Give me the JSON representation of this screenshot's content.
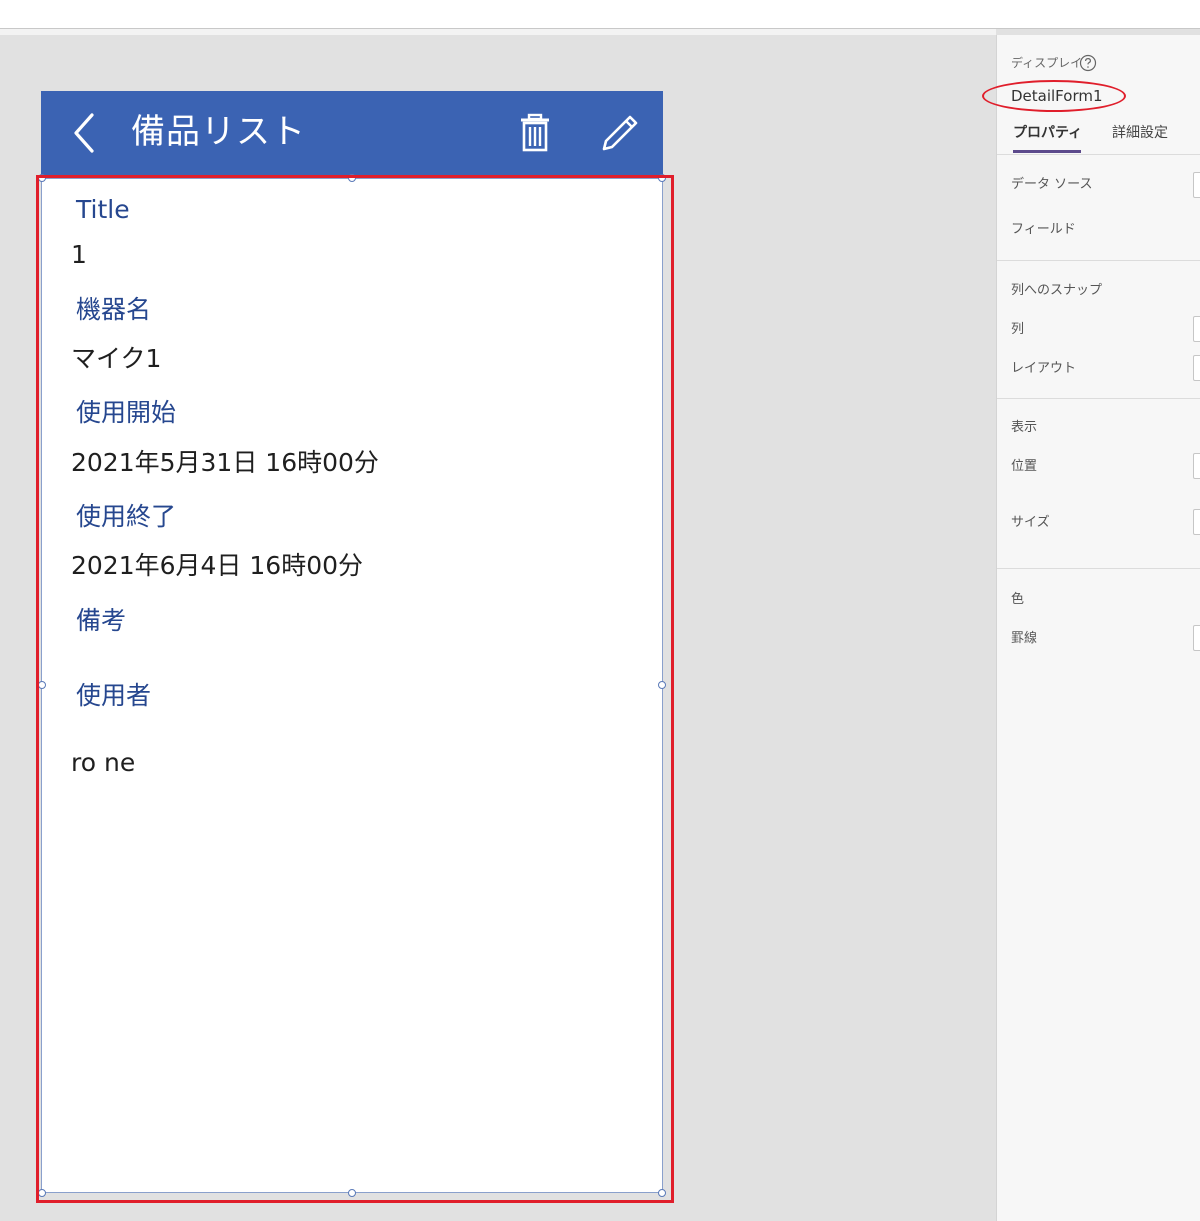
{
  "app": {
    "title": "備品リスト",
    "header_color": "#3b63b3",
    "icons": {
      "back": "chevron-left-icon",
      "delete": "trash-icon",
      "edit": "pencil-icon"
    }
  },
  "form": {
    "fields": [
      {
        "label": "Title",
        "value": "1"
      },
      {
        "label": "機器名",
        "value": "マイク1"
      },
      {
        "label": "使用開始",
        "value": "2021年5月31日 16時00分"
      },
      {
        "label": "使用終了",
        "value": "2021年6月4日 16時00分"
      },
      {
        "label": "備考",
        "value": ""
      },
      {
        "label": "使用者",
        "value": "ro ne"
      }
    ],
    "selection_color": "#e01e2b"
  },
  "panel": {
    "section_type": "ディスプレイ",
    "control_name": "DetailForm1",
    "tabs": {
      "properties": "プロパティ",
      "advanced": "詳細設定"
    },
    "rows": {
      "data_source": "データ ソース",
      "fields": "フィールド",
      "snap_to_columns": "列へのスナップ",
      "columns": "列",
      "layout": "レイアウト",
      "visible": "表示",
      "position": "位置",
      "size": "サイズ",
      "color": "色",
      "border": "罫線"
    }
  }
}
